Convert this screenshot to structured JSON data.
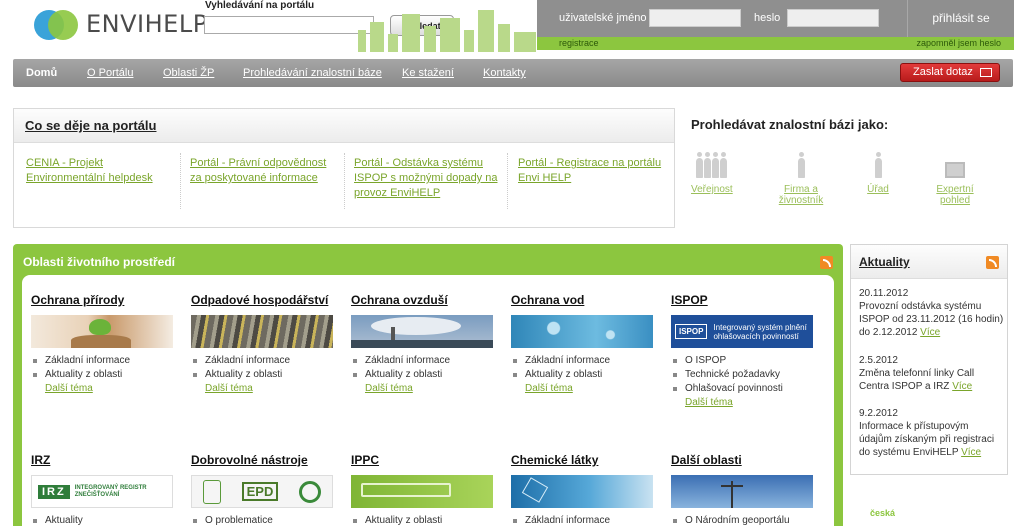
{
  "brand": {
    "name": "ENVIHELP"
  },
  "search": {
    "label": "Vyhledávání na portálu",
    "value": "",
    "placeholder": "",
    "button": "Vyhledat"
  },
  "login": {
    "username_label": "uživatelské jméno",
    "password_label": "heslo",
    "submit": "přihlásit se",
    "register": "registrace",
    "forgot": "zapomněl jsem heslo"
  },
  "nav": {
    "items": [
      "Domů",
      "O Portálu",
      "Oblasti ŽP",
      "Prohledávání znalostní báze",
      "Ke stažení",
      "Kontakty"
    ],
    "ask": "Zaslat dotaz"
  },
  "news": {
    "title": "Co se děje na portálu",
    "items": [
      "CENIA -  Projekt Environmentální helpdesk",
      "Portál -  Právní odpovědnost za poskytované informace",
      "Portál -  Odstávka systému ISPOP s možnými dopady na provoz EnviHELP",
      "Portál -  Registrace na portálu Envi HELP"
    ]
  },
  "kb": {
    "title": "Prohledávat znalostní bázi jako:",
    "items": [
      "Veřejnost",
      "Firma a živnostník",
      "Úřad",
      "Expertní pohled"
    ]
  },
  "areas": {
    "title": "Oblasti životního prostředí",
    "row1": [
      {
        "title": "Ochrana přírody",
        "links": [
          "Základní informace",
          "Aktuality z oblasti"
        ],
        "more": "Další téma"
      },
      {
        "title": "Odpadové hospodářství",
        "links": [
          "Základní informace",
          "Aktuality z oblasti"
        ],
        "more": "Další téma"
      },
      {
        "title": "Ochrana ovzduší",
        "links": [
          "Základní informace",
          "Aktuality z oblasti"
        ],
        "more": "Další téma"
      },
      {
        "title": "Ochrana vod",
        "links": [
          "Základní informace",
          "Aktuality z oblasti"
        ],
        "more": "Další téma"
      },
      {
        "title": "ISPOP",
        "links": [
          "O ISPOP",
          "Technické požadavky",
          "Ohlašovací povinnosti"
        ],
        "more": "Další téma",
        "banner": "Integrovaný systém plnění ohlašovacích povinností",
        "badge": "ISPOP"
      }
    ],
    "row2": [
      {
        "title": "IRZ",
        "links": [
          "Aktuality"
        ],
        "banner": "INTEGROVANÝ REGISTR ZNEČIŠŤOVÁNÍ",
        "badge": "IRZ"
      },
      {
        "title": "Dobrovolné nástroje",
        "links": [
          "O problematice"
        ],
        "badge": "EPD"
      },
      {
        "title": "IPPC",
        "links": [
          "Aktuality z oblasti"
        ]
      },
      {
        "title": "Chemické látky",
        "links": [
          "Základní informace"
        ]
      },
      {
        "title": "Další oblasti",
        "links": [
          "O Národním geoportálu"
        ]
      }
    ]
  },
  "aktuality": {
    "title": "Aktuality",
    "items": [
      {
        "date": "20.11.2012",
        "text": "Provozní odstávka systému ISPOP od 23.11.2012 (16 hodin) do 2.12.2012",
        "more": "Více"
      },
      {
        "date": "2.5.2012",
        "text": "Změna telefonní linky Call Centra ISPOP a IRZ",
        "more": "Více"
      },
      {
        "date": "9.2.2012",
        "text": "Informace k přístupovým údajům získaným při registraci do systému EnviHELP",
        "more": "Více"
      }
    ]
  },
  "footer_logo": "česká",
  "colors": {
    "accent": "#8cc63f",
    "nav": "#9a9a9a",
    "ask": "#c62828",
    "login": "#8f8f8f"
  }
}
